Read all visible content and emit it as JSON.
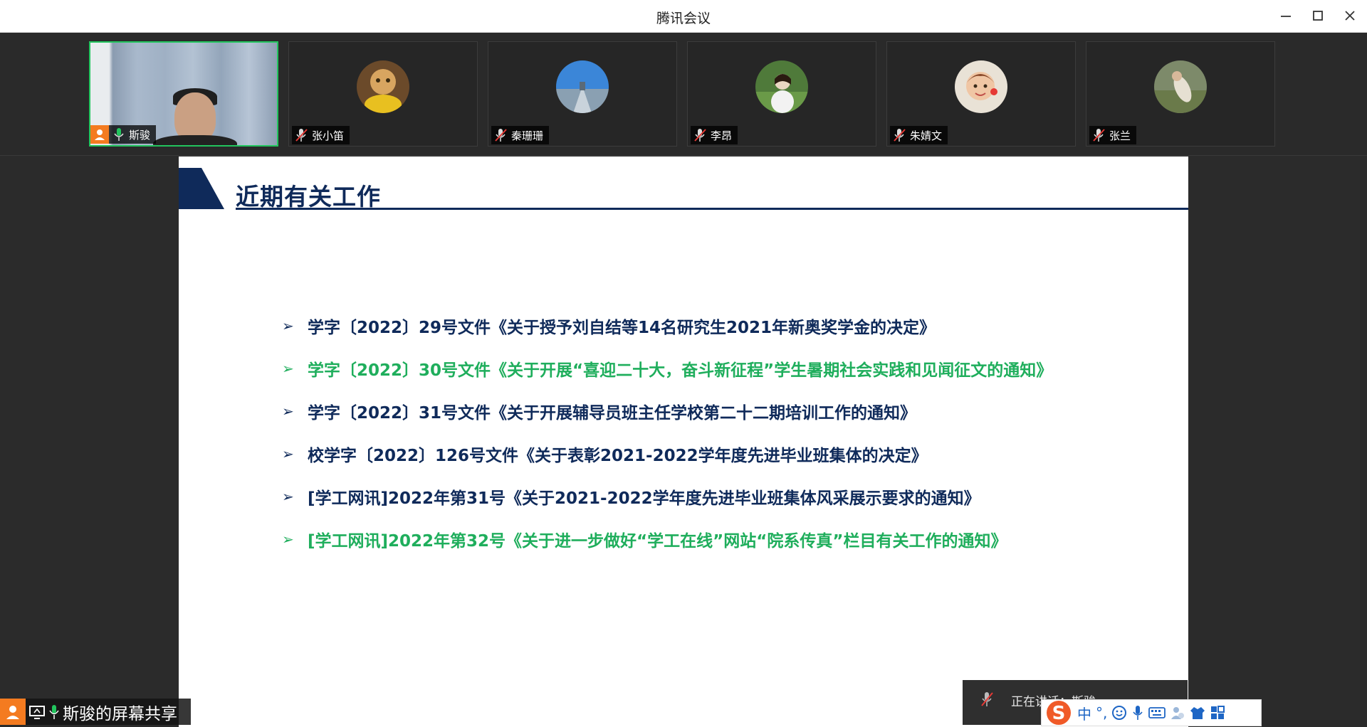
{
  "window": {
    "title": "腾讯会议"
  },
  "participants": [
    {
      "name": "斯骏",
      "muted": false,
      "active": true
    },
    {
      "name": "张小笛",
      "muted": true
    },
    {
      "name": "秦珊珊",
      "muted": true
    },
    {
      "name": "李昂",
      "muted": true
    },
    {
      "name": "朱婧文",
      "muted": true
    },
    {
      "name": "张兰",
      "muted": true
    }
  ],
  "slide": {
    "heading": "近期有关工作",
    "items": [
      {
        "text": "学字〔2022〕29号文件《关于授予刘自结等14名研究生2021年新奥奖学金的决定》",
        "color": "#0f2a5a"
      },
      {
        "text": "学字〔2022〕30号文件《关于开展“喜迎二十大，奋斗新征程”学生暑期社会实践和见闻征文的通知》",
        "color": "#1fae5c"
      },
      {
        "text": "学字〔2022〕31号文件《关于开展辅导员班主任学校第二十二期培训工作的通知》",
        "color": "#0f2a5a"
      },
      {
        "text": "校学字〔2022〕126号文件《关于表彰2021-2022学年度先进毕业班集体的决定》",
        "color": "#0f2a5a"
      },
      {
        "text": "[学工网讯]2022年第31号《关于2021-2022学年度先进毕业班集体风采展示要求的通知》",
        "color": "#0f2a5a"
      },
      {
        "text": "[学工网讯]2022年第32号《关于进一步做好“学工在线”网站“院系传真”栏目有关工作的通知》",
        "color": "#1fae5c"
      }
    ]
  },
  "share_label": "斯骏的屏幕共享",
  "speaking": {
    "text": "正在讲话：斯骏"
  },
  "ime": {
    "lang": "中",
    "punct": "°,"
  },
  "colors": {
    "accent_green": "#22c55e",
    "navy": "#0f2a5a",
    "user_orange": "#f47b20"
  }
}
